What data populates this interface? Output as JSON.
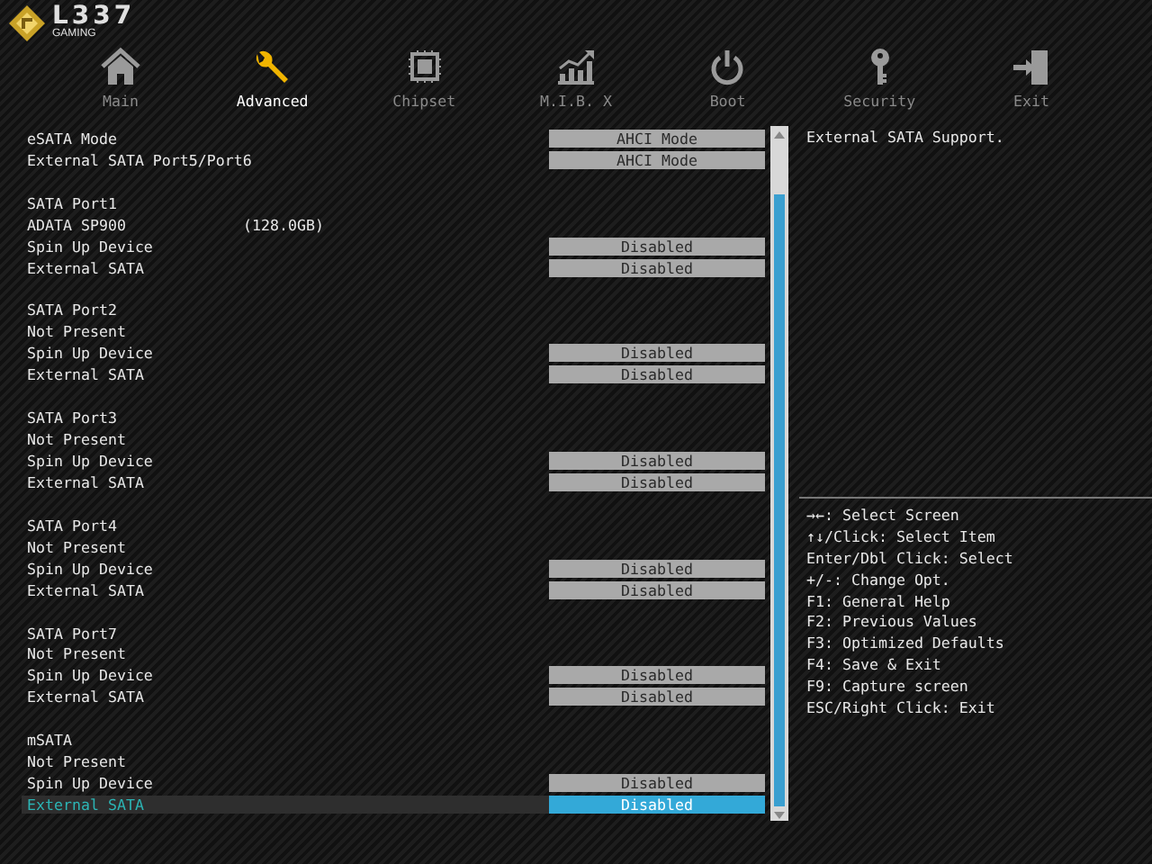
{
  "logo": {
    "title": "L337",
    "subtitle": "GAMING"
  },
  "tabs": [
    {
      "label": "Main",
      "selected": false
    },
    {
      "label": "Advanced",
      "selected": true
    },
    {
      "label": "Chipset",
      "selected": false
    },
    {
      "label": "M.I.B. X",
      "selected": false
    },
    {
      "label": "Boot",
      "selected": false
    },
    {
      "label": "Security",
      "selected": false
    },
    {
      "label": "Exit",
      "selected": false
    }
  ],
  "groups": [
    {
      "items": [
        {
          "kind": "setting",
          "label": "eSATA Mode",
          "value": "AHCI Mode",
          "selected": false
        },
        {
          "kind": "setting",
          "label": "External SATA Port5/Port6",
          "value": "AHCI Mode",
          "selected": false
        }
      ]
    },
    {
      "items": [
        {
          "kind": "text",
          "label": "SATA Port1"
        },
        {
          "kind": "text",
          "label": "ADATA SP900",
          "detail": "(128.0GB)"
        },
        {
          "kind": "setting",
          "label": "Spin Up Device",
          "value": "Disabled",
          "selected": false
        },
        {
          "kind": "setting",
          "label": "External SATA",
          "value": "Disabled",
          "selected": false
        }
      ]
    },
    {
      "items": [
        {
          "kind": "text",
          "label": "SATA Port2"
        },
        {
          "kind": "text",
          "label": "Not Present"
        },
        {
          "kind": "setting",
          "label": "Spin Up Device",
          "value": "Disabled",
          "selected": false
        },
        {
          "kind": "setting",
          "label": "External SATA",
          "value": "Disabled",
          "selected": false
        }
      ]
    },
    {
      "items": [
        {
          "kind": "text",
          "label": "SATA Port3"
        },
        {
          "kind": "text",
          "label": "Not Present"
        },
        {
          "kind": "setting",
          "label": "Spin Up Device",
          "value": "Disabled",
          "selected": false
        },
        {
          "kind": "setting",
          "label": "External SATA",
          "value": "Disabled",
          "selected": false
        }
      ]
    },
    {
      "items": [
        {
          "kind": "text",
          "label": "SATA Port4"
        },
        {
          "kind": "text",
          "label": "Not Present"
        },
        {
          "kind": "setting",
          "label": "Spin Up Device",
          "value": "Disabled",
          "selected": false
        },
        {
          "kind": "setting",
          "label": "External SATA",
          "value": "Disabled",
          "selected": false
        }
      ]
    },
    {
      "items": [
        {
          "kind": "text",
          "label": "SATA Port7"
        },
        {
          "kind": "text",
          "label": "Not Present"
        },
        {
          "kind": "setting",
          "label": "Spin Up Device",
          "value": "Disabled",
          "selected": false
        },
        {
          "kind": "setting",
          "label": "External SATA",
          "value": "Disabled",
          "selected": false
        }
      ]
    },
    {
      "items": [
        {
          "kind": "text",
          "label": "mSATA"
        },
        {
          "kind": "text",
          "label": "Not Present"
        },
        {
          "kind": "setting",
          "label": "Spin Up Device",
          "value": "Disabled",
          "selected": false
        },
        {
          "kind": "setting",
          "label": "External SATA",
          "value": "Disabled",
          "selected": true
        }
      ]
    }
  ],
  "help": "External SATA Support.",
  "keys": [
    "→←: Select Screen",
    "↑↓/Click: Select Item",
    "Enter/Dbl Click: Select",
    "+/-: Change Opt.",
    "F1: General Help",
    "F2: Previous Values",
    "F3: Optimized Defaults",
    "F4: Save & Exit",
    "F9: Capture screen",
    "ESC/Right Click: Exit"
  ]
}
